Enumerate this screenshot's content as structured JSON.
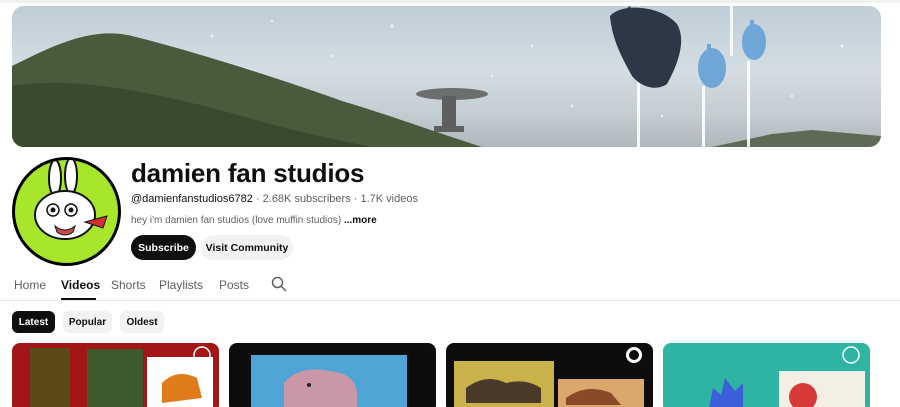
{
  "channel": {
    "name": "damien fan studios",
    "handle": "@damienfanstudios6782",
    "subscribers": "2.68K subscribers",
    "videos": "1.7K videos",
    "separator": " · ",
    "description": "hey i'm damien fan studios (love muffin studios)",
    "more_label": "...more"
  },
  "actions": {
    "subscribe_label": "Subscribe",
    "community_label": "Visit Community"
  },
  "tabs": [
    {
      "label": "Home",
      "active": false
    },
    {
      "label": "Videos",
      "active": true
    },
    {
      "label": "Shorts",
      "active": false
    },
    {
      "label": "Playlists",
      "active": false
    },
    {
      "label": "Posts",
      "active": false
    }
  ],
  "filters": [
    {
      "label": "Latest",
      "active": true
    },
    {
      "label": "Popular",
      "active": false
    },
    {
      "label": "Oldest",
      "active": false
    }
  ],
  "icons": {
    "tab_search": "search-icon"
  },
  "colors": {
    "primary_button": "#0f0f0f",
    "avatar_bg": "#a7e62a"
  }
}
